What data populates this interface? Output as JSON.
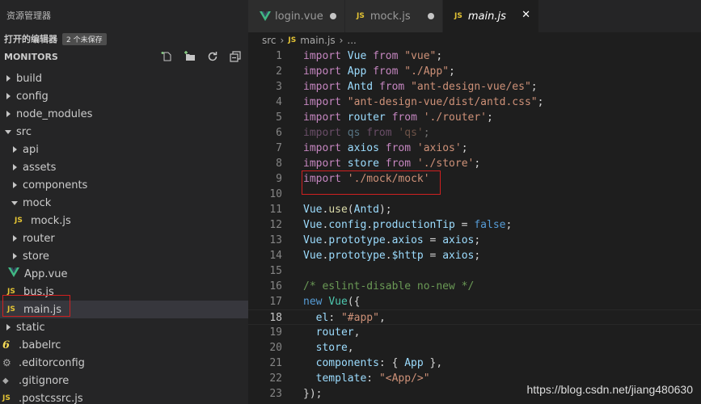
{
  "sidebar": {
    "title": "资源管理器",
    "open_editors_label": "打开的编辑器",
    "unsaved_badge": "2 个未保存",
    "folder_name": "MONITORS",
    "tree": [
      {
        "label": "build"
      },
      {
        "label": "config"
      },
      {
        "label": "node_modules"
      },
      {
        "label": "src"
      },
      {
        "label": "api"
      },
      {
        "label": "assets"
      },
      {
        "label": "components"
      },
      {
        "label": "mock"
      },
      {
        "label": "mock.js",
        "icon": "JS"
      },
      {
        "label": "router"
      },
      {
        "label": "store"
      },
      {
        "label": "App.vue"
      },
      {
        "label": "bus.js",
        "icon": "JS"
      },
      {
        "label": "main.js",
        "icon": "JS"
      },
      {
        "label": "static"
      },
      {
        "label": ".babelrc"
      },
      {
        "label": ".editorconfig"
      },
      {
        "label": ".gitignore"
      },
      {
        "label": ".postcssrc.js",
        "icon": "JS"
      }
    ]
  },
  "tabs": [
    {
      "label": "login.vue",
      "state": "unsaved"
    },
    {
      "label": "mock.js",
      "icon": "JS",
      "state": "unsaved"
    },
    {
      "label": "main.js",
      "icon": "JS",
      "state": "active"
    }
  ],
  "breadcrumb": {
    "folder": "src",
    "icon": "JS",
    "file": "main.js",
    "more": "..."
  },
  "code": {
    "current_line": 18,
    "lines": [
      {
        "n": "1",
        "t": [
          [
            "import",
            "kw2"
          ],
          [
            " Vue ",
            "var"
          ],
          [
            "from",
            "kw2"
          ],
          [
            " ",
            ""
          ],
          [
            "\"vue\"",
            "str"
          ],
          [
            ";",
            ""
          ]
        ]
      },
      {
        "n": "2",
        "t": [
          [
            "import",
            "kw2"
          ],
          [
            " App ",
            "var"
          ],
          [
            "from",
            "kw2"
          ],
          [
            " ",
            ""
          ],
          [
            "\"./App\"",
            "str"
          ],
          [
            ";",
            ""
          ]
        ]
      },
      {
        "n": "3",
        "t": [
          [
            "import",
            "kw2"
          ],
          [
            " Antd ",
            "var"
          ],
          [
            "from",
            "kw2"
          ],
          [
            " ",
            ""
          ],
          [
            "\"ant-design-vue/es\"",
            "str"
          ],
          [
            ";",
            ""
          ]
        ]
      },
      {
        "n": "4",
        "t": [
          [
            "import",
            "kw2"
          ],
          [
            " ",
            ""
          ],
          [
            "\"ant-design-vue/dist/antd.css\"",
            "str"
          ],
          [
            ";",
            ""
          ]
        ]
      },
      {
        "n": "5",
        "t": [
          [
            "import",
            "kw2"
          ],
          [
            " router ",
            "var"
          ],
          [
            "from",
            "kw2"
          ],
          [
            " ",
            ""
          ],
          [
            "'./router'",
            "str"
          ],
          [
            ";",
            ""
          ]
        ]
      },
      {
        "n": "6",
        "dim": true,
        "t": [
          [
            "import",
            "kw2"
          ],
          [
            " qs ",
            "var"
          ],
          [
            "from",
            "kw2"
          ],
          [
            " ",
            ""
          ],
          [
            "'qs'",
            "str"
          ],
          [
            ";",
            ""
          ]
        ]
      },
      {
        "n": "7",
        "t": [
          [
            "import",
            "kw2"
          ],
          [
            " axios ",
            "var"
          ],
          [
            "from",
            "kw2"
          ],
          [
            " ",
            ""
          ],
          [
            "'axios'",
            "str"
          ],
          [
            ";",
            ""
          ]
        ]
      },
      {
        "n": "8",
        "t": [
          [
            "import",
            "kw2"
          ],
          [
            " store ",
            "var"
          ],
          [
            "from",
            "kw2"
          ],
          [
            " ",
            ""
          ],
          [
            "'./store'",
            "str"
          ],
          [
            ";",
            ""
          ]
        ]
      },
      {
        "n": "9",
        "t": [
          [
            "import",
            "kw2"
          ],
          [
            " ",
            ""
          ],
          [
            "'./mock/mock'",
            "str"
          ]
        ]
      },
      {
        "n": "10",
        "t": []
      },
      {
        "n": "11",
        "t": [
          [
            "Vue",
            "var"
          ],
          [
            ".",
            ""
          ],
          [
            "use",
            "fn"
          ],
          [
            "(",
            ""
          ],
          [
            "Antd",
            "var"
          ],
          [
            ");",
            ""
          ]
        ]
      },
      {
        "n": "12",
        "t": [
          [
            "Vue",
            "var"
          ],
          [
            ".",
            ""
          ],
          [
            "config",
            "var"
          ],
          [
            ".",
            ""
          ],
          [
            "productionTip",
            "var"
          ],
          [
            " = ",
            ""
          ],
          [
            "false",
            "kw"
          ],
          [
            ";",
            ""
          ]
        ]
      },
      {
        "n": "13",
        "t": [
          [
            "Vue",
            "var"
          ],
          [
            ".",
            ""
          ],
          [
            "prototype",
            "var"
          ],
          [
            ".",
            ""
          ],
          [
            "axios",
            "var"
          ],
          [
            " = ",
            ""
          ],
          [
            "axios",
            "var"
          ],
          [
            ";",
            ""
          ]
        ]
      },
      {
        "n": "14",
        "t": [
          [
            "Vue",
            "var"
          ],
          [
            ".",
            ""
          ],
          [
            "prototype",
            "var"
          ],
          [
            ".",
            ""
          ],
          [
            "$http",
            "var"
          ],
          [
            " = ",
            ""
          ],
          [
            "axios",
            "var"
          ],
          [
            ";",
            ""
          ]
        ]
      },
      {
        "n": "15",
        "t": []
      },
      {
        "n": "16",
        "t": [
          [
            "/* eslint-disable no-new */",
            "cmt"
          ]
        ]
      },
      {
        "n": "17",
        "t": [
          [
            "new",
            "kw"
          ],
          [
            " ",
            ""
          ],
          [
            "Vue",
            "cls"
          ],
          [
            "({",
            ""
          ]
        ]
      },
      {
        "n": "18",
        "t": [
          [
            "  el",
            "var"
          ],
          [
            ": ",
            ""
          ],
          [
            "\"#app\"",
            "str"
          ],
          [
            ",",
            ""
          ]
        ]
      },
      {
        "n": "19",
        "t": [
          [
            "  router",
            "var"
          ],
          [
            ",",
            ""
          ]
        ]
      },
      {
        "n": "20",
        "t": [
          [
            "  store",
            "var"
          ],
          [
            ",",
            ""
          ]
        ]
      },
      {
        "n": "21",
        "t": [
          [
            "  components",
            "var"
          ],
          [
            ": { ",
            ""
          ],
          [
            "App",
            "var"
          ],
          [
            " },",
            ""
          ]
        ]
      },
      {
        "n": "22",
        "t": [
          [
            "  template",
            "var"
          ],
          [
            ": ",
            ""
          ],
          [
            "\"<App/>\"",
            "str"
          ]
        ]
      },
      {
        "n": "23",
        "t": [
          [
            "});",
            ""
          ]
        ]
      }
    ]
  },
  "watermark": "https://blog.csdn.net/jiang480630"
}
